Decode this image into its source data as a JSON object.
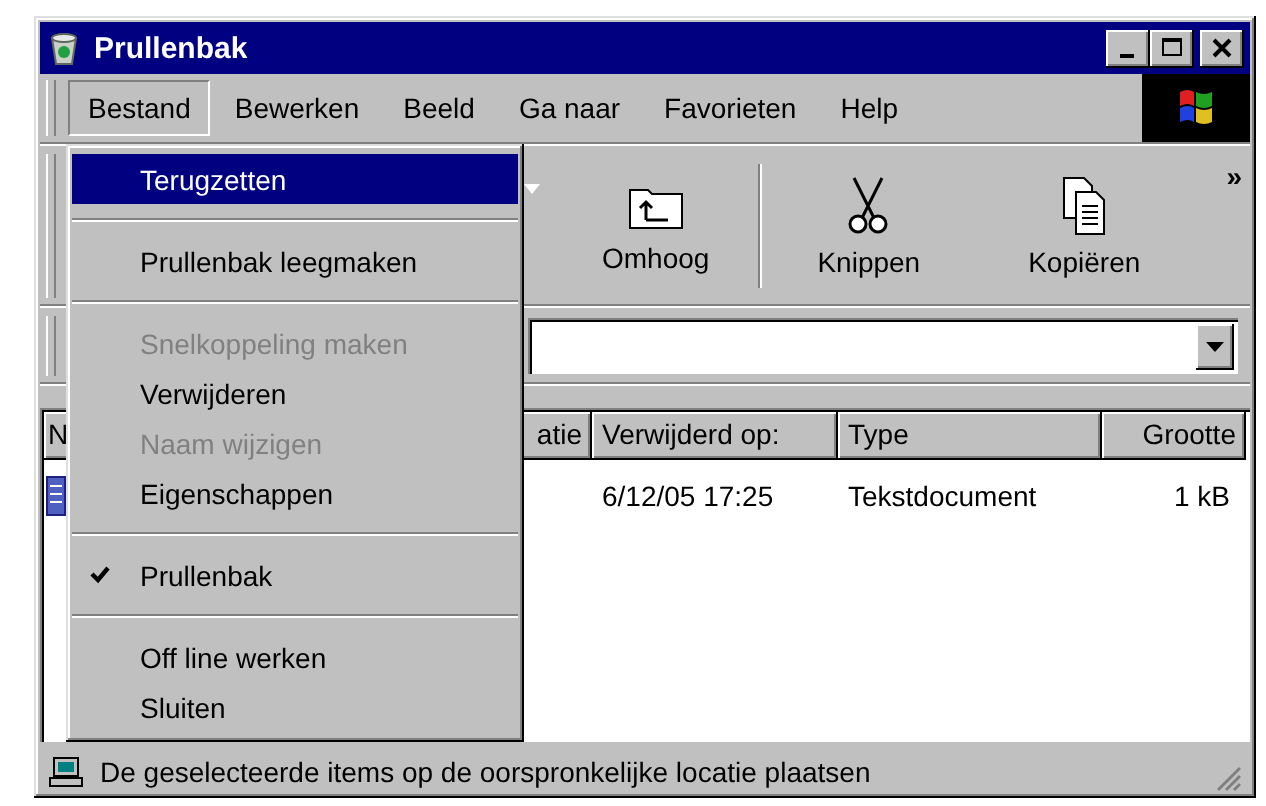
{
  "window": {
    "title": "Prullenbak"
  },
  "menu_bar": [
    {
      "label": "Bestand",
      "selected": true
    },
    {
      "label": "Bewerken",
      "selected": false
    },
    {
      "label": "Beeld",
      "selected": false
    },
    {
      "label": "Ga naar",
      "selected": false
    },
    {
      "label": "Favorieten",
      "selected": false
    },
    {
      "label": "Help",
      "selected": false
    }
  ],
  "menu": [
    {
      "kind": "item",
      "label": "Terugzetten",
      "selected": true,
      "disabled": false,
      "checked": false
    },
    {
      "kind": "separator"
    },
    {
      "kind": "item",
      "label": "Prullenbak leegmaken",
      "selected": false,
      "disabled": false,
      "checked": false
    },
    {
      "kind": "separator"
    },
    {
      "kind": "item",
      "label": "Snelkoppeling maken",
      "selected": false,
      "disabled": true,
      "checked": false
    },
    {
      "kind": "item",
      "label": "Verwijderen",
      "selected": false,
      "disabled": false,
      "checked": false
    },
    {
      "kind": "item",
      "label": "Naam wijzigen",
      "selected": false,
      "disabled": true,
      "checked": false
    },
    {
      "kind": "item",
      "label": "Eigenschappen",
      "selected": false,
      "disabled": false,
      "checked": false
    },
    {
      "kind": "separator"
    },
    {
      "kind": "item",
      "label": "Prullenbak",
      "selected": false,
      "disabled": false,
      "checked": true
    },
    {
      "kind": "separator"
    },
    {
      "kind": "item",
      "label": "Off line werken",
      "selected": false,
      "disabled": false,
      "checked": false
    },
    {
      "kind": "item",
      "label": "Sluiten",
      "selected": false,
      "disabled": false,
      "checked": false
    }
  ],
  "toolbar": {
    "buttons": [
      {
        "kind": "up",
        "label": "Omhoog"
      },
      {
        "kind": "cut",
        "label": "Knippen"
      },
      {
        "kind": "copy",
        "label": "Kopiëren"
      }
    ],
    "more": "»"
  },
  "table": {
    "columns": [
      "N",
      "atie",
      "Verwijderd op:",
      "Type",
      "Grootte"
    ],
    "rows": [
      {
        "cells": [
          "",
          "",
          "6/12/05 17:25",
          "Tekstdocument",
          "1 kB"
        ]
      }
    ]
  },
  "status_bar": "De geselecteerde items op de oorspronkelijke locatie plaatsen"
}
